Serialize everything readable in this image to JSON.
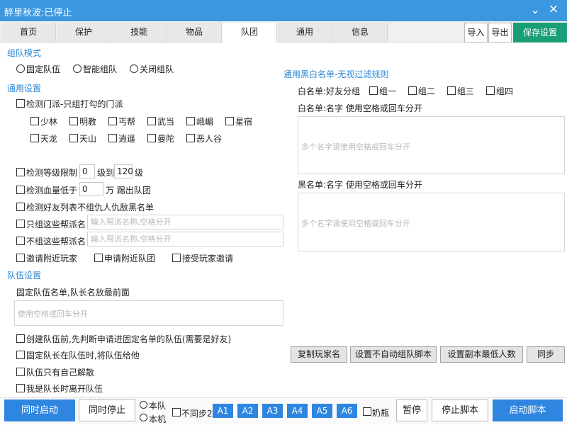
{
  "window": {
    "title": "醉里秋波:已停止",
    "minimize": "✕",
    "close": "✕"
  },
  "tabs": [
    "首页",
    "保护",
    "技能",
    "物品",
    "队团",
    "通用",
    "信息"
  ],
  "toolbar": {
    "import": "导入",
    "export": "导出",
    "save": "保存设置"
  },
  "team_mode": {
    "section": "组队模式",
    "options": [
      "固定队伍",
      "智能组队",
      "关闭组队"
    ]
  },
  "general": {
    "section": "通用设置",
    "check_sect": "检测门派-只组打勾的门派",
    "sects": [
      "少林",
      "明教",
      "丐帮",
      "武当",
      "峨嵋",
      "星宿",
      "天龙",
      "天山",
      "逍遥",
      "曼陀",
      "恶人谷"
    ],
    "level_prefix": "检测等级限制",
    "level_min": "0",
    "level_mid": "级到",
    "level_max": "120",
    "level_suffix": "级",
    "hp_prefix": "检测血量低于",
    "hp_value": "0",
    "hp_suffix": "万 踢出队团",
    "check_friends": "检测好友列表不组仇人仇敌黑名单",
    "only_guild": "只组这些帮派名",
    "only_guild_ph": "输入帮派名称,空格分开",
    "not_guild": "不组这些帮派名",
    "not_guild_ph": "输入帮派名称,空格分开",
    "invite_nearby": "邀请附近玩家",
    "apply_nearby": "申请附近队团",
    "accept_invite": "接受玩家邀请"
  },
  "team": {
    "section": "队伍设置",
    "fixed_label": "固定队伍名单,队长名放最前面",
    "fixed_ph": "使用空格或回车分开",
    "opt1": "创建队伍前,先判断申请进固定名单的队伍(需要是好友)",
    "opt2": "固定队长在队伍时,将队伍给他",
    "opt3": "队伍只有自己解散",
    "opt4": "我是队长时离开队伍"
  },
  "lists": {
    "section": "通用黑白名单-无视过滤规则",
    "white_group": "白名单:好友分组",
    "groups": [
      "组一",
      "组二",
      "组三",
      "组四"
    ],
    "white_names": "白名单:名字 使用空格或回车分开",
    "white_ph": "多个名字请使用空格或回车分开",
    "black_names": "黑名单:名字 使用空格或回车分开",
    "black_ph": "多个名字请使用空格或回车分开"
  },
  "actions": {
    "copy_name": "复制玩家名",
    "no_auto": "设置不自动组队脚本",
    "min_people": "设置副本最低人数",
    "sync": "同步"
  },
  "bottom": {
    "start_all": "同时启动",
    "stop_all": "同时停止",
    "this_team": "本队",
    "this_machine": "本机",
    "no_sync": "不同步2",
    "accounts": [
      "A1",
      "A2",
      "A3",
      "A4",
      "A5",
      "A6"
    ],
    "milk": "奶瓶",
    "pause": "暂停",
    "stop": "停止脚本",
    "start": "启动脚本"
  },
  "colors": {
    "accent": "#3a97e0",
    "section": "#2b86d6",
    "save": "#1a9e77"
  }
}
